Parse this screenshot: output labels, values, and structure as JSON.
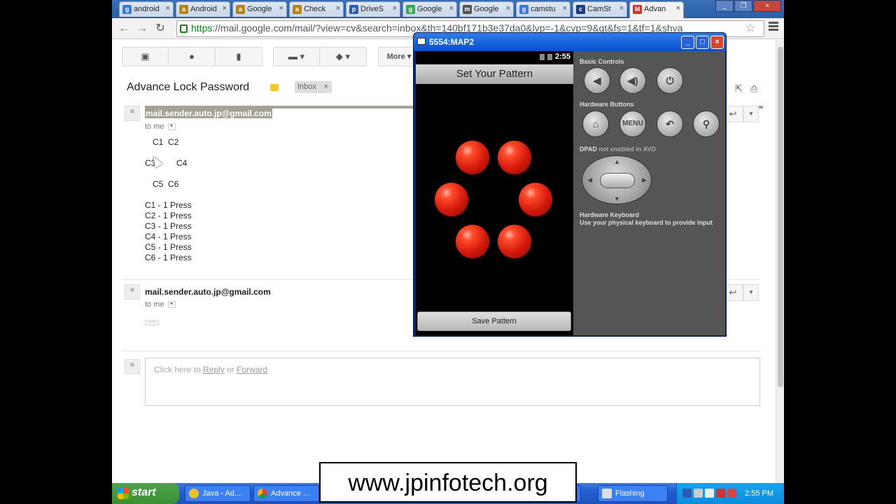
{
  "browser": {
    "tabs": [
      {
        "label": "android",
        "fav": "g",
        "color": "#3b78e7"
      },
      {
        "label": "Android",
        "fav": "a",
        "color": "#b8860b"
      },
      {
        "label": "Google",
        "fav": "a",
        "color": "#b8860b"
      },
      {
        "label": "Check",
        "fav": "a",
        "color": "#b8860b"
      },
      {
        "label": "DriveS",
        "fav": "p",
        "color": "#2a5db0"
      },
      {
        "label": "Google",
        "fav": "g",
        "color": "#34a853"
      },
      {
        "label": "Google",
        "fav": "m",
        "color": "#555555"
      },
      {
        "label": "camstu",
        "fav": "g",
        "color": "#3b78e7"
      },
      {
        "label": "CamSt",
        "fav": "c",
        "color": "#1a3a8a"
      },
      {
        "label": "Advan",
        "fav": "M",
        "color": "#d93025"
      }
    ],
    "url_scheme": "https",
    "url_rest": "://mail.google.com/mail/?view=cv&search=inbox&th=140bf171b3e37da0&lvp=-1&cvp=9&qt&fs=1&tf=1&shva"
  },
  "gmail": {
    "toolbar": {
      "archive_icon": "archive-icon",
      "spam_icon": "report-spam-icon",
      "delete_icon": "trash-icon",
      "folder_icon": "folder-icon",
      "label_icon": "label-icon",
      "more_label": "More"
    },
    "subject": "Advance Lock Password",
    "label_chip": "Inbox",
    "message1": {
      "sender": "mail.sender.auto.jp@gmail.com",
      "to": "to me",
      "row1": "C1  C2",
      "row2a": "C3",
      "row2b": "C4",
      "row3": "C5  C6",
      "presses": [
        "C1 - 1 Press",
        "C2 - 1 Press",
        "C3 - 1 Press",
        "C4 - 1 Press",
        "C5 - 1 Press",
        "C6 - 1 Press"
      ]
    },
    "message2": {
      "sender": "mail.sender.auto.jp@gmail.com",
      "to": "to me"
    },
    "reply": {
      "prefix": "Click here to ",
      "reply_link": "Reply",
      "middle": " or ",
      "forward_link": "Forward"
    }
  },
  "emulator": {
    "title": "5554:MAP2",
    "time": "2:55",
    "screen_title": "Set Your Pattern",
    "save_button": "Save Pattern",
    "basic_controls": "Basic Controls",
    "hardware_buttons": "Hardware Buttons",
    "menu_label": "MENU",
    "dpad_label": "DPAD",
    "dpad_note": "not enabled in AVD",
    "keyboard_title": "Hardware Keyboard",
    "keyboard_note": "Use your physical keyboard to provide input",
    "dot_color": "#d41a0b"
  },
  "watermark": "www.jpinfotech.org",
  "taskbar": {
    "start": "start",
    "tasks": [
      "Java - Ad...",
      "Advance ...",
      "Flashing"
    ],
    "clock": "2:55 PM"
  }
}
